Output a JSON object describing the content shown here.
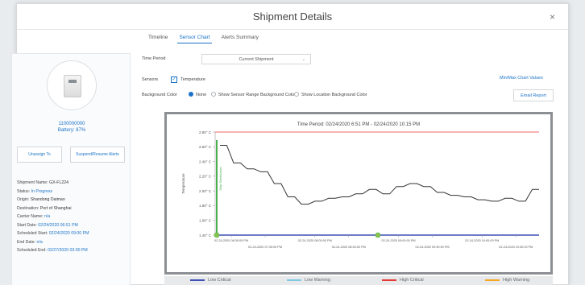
{
  "modal": {
    "title": "Shipment Details",
    "close_label": "×"
  },
  "tabs": [
    {
      "label": "Timeline",
      "active": false
    },
    {
      "label": "Sensor Chart",
      "active": true
    },
    {
      "label": "Alerts Summary",
      "active": false
    }
  ],
  "device": {
    "id": "1100000000",
    "battery": "Battery: 87%",
    "unassign_label": "Unassign To",
    "suspend_label": "Suspend/Resume Alerts"
  },
  "shipment_info": [
    {
      "label": "Shipment Name:",
      "value": "GX-FL224",
      "value_style": "dark"
    },
    {
      "label": "Status:",
      "value": "In Progress",
      "value_style": "link"
    },
    {
      "label": "Origin:",
      "value": "Shandong Daimao",
      "value_style": "dark"
    },
    {
      "label": "Destination:",
      "value": "Port of Shanghai",
      "value_style": "dark"
    },
    {
      "label": "Carrier Name:",
      "value": "n/a",
      "value_style": "link"
    },
    {
      "label": "Start Date:",
      "value": "02/24/2020 06:51 PM",
      "value_style": "link"
    },
    {
      "label": "Scheduled Start:",
      "value": "02/24/2020 09:00 PM",
      "value_style": "link"
    },
    {
      "label": "End Date:",
      "value": "n/a",
      "value_style": "link"
    },
    {
      "label": "Scheduled End:",
      "value": "02/27/2020 03:00 PM",
      "value_style": "link"
    }
  ],
  "controls": {
    "time_period_label": "Time Period",
    "time_period_value": "Current Shipment",
    "sensors_label": "Sensors",
    "sensor_temperature": "Temperature",
    "background_label": "Background Color",
    "bg_option_none": "None",
    "bg_option_range": "Show Sensor Range Background Color",
    "bg_option_location": "Show Location Background Color",
    "minmax_link": "Min/Max Chart Values",
    "export_button": "Email Report"
  },
  "chart_data": {
    "type": "line",
    "title": "Time Period: 02/24/2020 6:51 PM - 02/24/2020 10:15 PM",
    "ylabel": "Temperature",
    "marker_label": "Ship Start/Arrive",
    "y_ticks": [
      "2.80° C",
      "2.60° C",
      "2.40° C",
      "2.20° C",
      "2.00° C",
      "1.80° C",
      "1.60° C",
      "1.40° C"
    ],
    "ylim": [
      1.4,
      2.8
    ],
    "x_ticks_upper": [
      "02-24-2020 06:30:00 PM",
      "02-24-2020 08:00:00 PM",
      "02-24-2020 09:00:00 PM",
      "02-24-2020 10:00:00 PM"
    ],
    "x_ticks_lower": [
      "02-24-2020 07:30:00 PM",
      "02-24-2020 08:30:00 PM",
      "02-24-2020 09:30:00 PM",
      "02-24-2020 10:30:00 PM"
    ],
    "thresholds": {
      "high_critical": 2.8,
      "low_critical": 1.4
    },
    "series": [
      {
        "name": "Temperature",
        "color": "#333333",
        "values": [
          2.62,
          2.62,
          2.38,
          2.38,
          2.3,
          2.3,
          2.26,
          2.26,
          2.1,
          2.1,
          1.92,
          1.92,
          1.82,
          1.82,
          1.86,
          1.86,
          1.9,
          1.9,
          1.92,
          1.92,
          1.96,
          1.96,
          2.02,
          2.02,
          1.96,
          1.96,
          2.06,
          2.06,
          2.1,
          2.1,
          2.06,
          2.06,
          1.98,
          1.98,
          1.94,
          1.94,
          1.92,
          1.92,
          1.88,
          1.88,
          1.86,
          1.86,
          1.9,
          1.9,
          1.86,
          1.86,
          2.02,
          2.02
        ]
      }
    ],
    "legend": [
      {
        "name": "Low Critical",
        "color": "#3f51b5"
      },
      {
        "name": "Low Warning",
        "color": "#7ec8e3"
      },
      {
        "name": "High Critical",
        "color": "#e53935"
      },
      {
        "name": "High Warning",
        "color": "#f5a623"
      }
    ]
  }
}
